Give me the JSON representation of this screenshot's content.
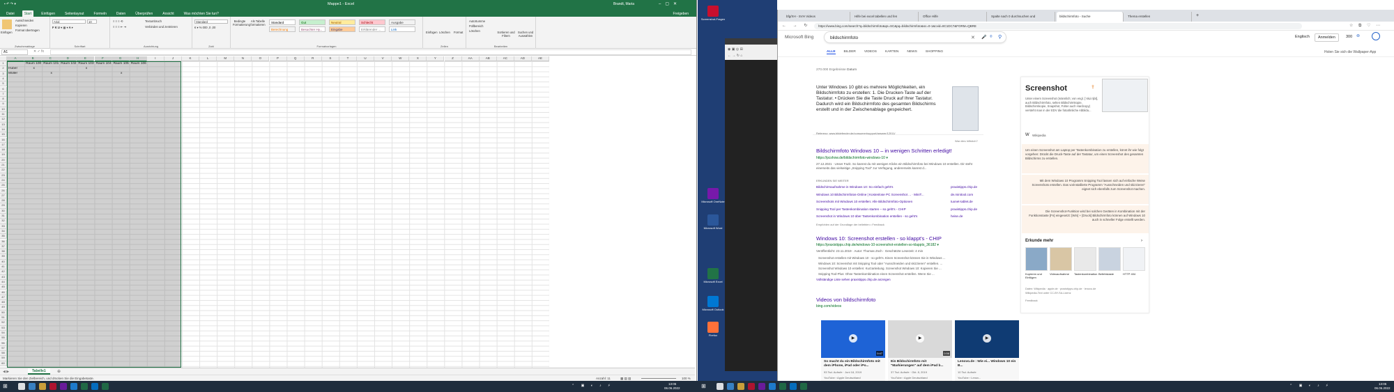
{
  "excel": {
    "window_title": "Mappe1 - Excel",
    "user": "Brandt, Maria",
    "share": "Freigeben",
    "tabs": [
      "Datei",
      "Start",
      "Einfügen",
      "Seitenlayout",
      "Formeln",
      "Daten",
      "Überprüfen",
      "Ansicht",
      "Was möchten Sie tun?"
    ],
    "active_tab": "Start",
    "ribbon": {
      "clipboard": {
        "paste": "Einfügen",
        "cut": "Ausschneiden",
        "copy": "Kopieren",
        "format_painter": "Format übertragen",
        "label": "Zwischenablage"
      },
      "font": {
        "name": "Arial",
        "size": "10",
        "label": "Schriftart"
      },
      "alignment": {
        "wrap": "Textumbruch",
        "merge": "Verbinden und zentrieren",
        "label": "Ausrichtung"
      },
      "number": {
        "format": "Standard",
        "label": "Zahl"
      },
      "conditional": "Bedingte Formatierung",
      "as_table": "Als Tabelle formatieren",
      "styles": [
        {
          "name": "Standard",
          "bg": "#ffffff",
          "fg": "#000000"
        },
        {
          "name": "Gut",
          "bg": "#c6efce",
          "fg": "#006100"
        },
        {
          "name": "Neutral",
          "bg": "#ffeb9c",
          "fg": "#9c5700"
        },
        {
          "name": "Schlecht",
          "bg": "#ffc7ce",
          "fg": "#9c0006"
        },
        {
          "name": "Ausgabe",
          "bg": "#f2f2f2",
          "fg": "#3f3f3f"
        },
        {
          "name": "Berechnung",
          "bg": "#f2f2f2",
          "fg": "#fa7d00"
        },
        {
          "name": "Besuchter Hy...",
          "bg": "#ffffff",
          "fg": "#954f72"
        },
        {
          "name": "Eingabe",
          "bg": "#ffcc99",
          "fg": "#3f3f76"
        },
        {
          "name": "Erklärender ...",
          "bg": "#ffffff",
          "fg": "#7f7f7f"
        },
        {
          "name": "Link",
          "bg": "#ffffff",
          "fg": "#0563c1"
        }
      ],
      "styles_label": "Formatvorlagen",
      "cells": {
        "insert": "Einfügen",
        "delete": "Löschen",
        "format": "Format",
        "label": "Zellen"
      },
      "editing": {
        "autosum": "AutoSumme",
        "fill": "Füllbereich",
        "clear": "Löschen",
        "sort": "Sortieren und Filtern",
        "find": "Suchen und Auswählen",
        "label": "Bearbeiten"
      }
    },
    "name_box": "A1",
    "columns": [
      "A",
      "B",
      "C",
      "D",
      "E",
      "F",
      "G",
      "H",
      "I",
      "J",
      "K",
      "L",
      "M",
      "N",
      "O",
      "P",
      "Q",
      "R",
      "S",
      "T",
      "U",
      "V",
      "W",
      "X",
      "Y",
      "Z",
      "AA",
      "AB",
      "AC",
      "AD",
      "AE"
    ],
    "cells": {
      "row1": [
        "",
        "Raum 100",
        "Raum 101",
        "Raum 102",
        "Raum 103",
        "Raum 104",
        "Raum 105",
        "Raum 106"
      ],
      "row2": [
        "Huber",
        "x",
        "",
        "",
        "x",
        "",
        "",
        ""
      ],
      "row3": [
        "Müller",
        "",
        "x",
        "",
        "",
        "",
        "x",
        ""
      ]
    },
    "sheet_tab": "Tabelle1",
    "status_text": "Markieren Sie den Zielbereich, und drücken Sie die Eingabetaste.",
    "count": "Anzahl: 11",
    "zoom": "100 %"
  },
  "desktop": {
    "icons": [
      {
        "label": "Screenshot-Fragen",
        "color": "#c8102e"
      },
      {
        "label": "Microsoft OneNote",
        "color": "#7719aa"
      },
      {
        "label": "Microsoft Word",
        "color": "#2b579a"
      },
      {
        "label": "Microsoft Excel",
        "color": "#217346"
      },
      {
        "label": "Microsoft Outlook",
        "color": "#0078d4"
      },
      {
        "label": "Firefox",
        "color": "#ff7139"
      }
    ]
  },
  "browser": {
    "tabs": [
      "bfg/XH - SVH Videos",
      "Hilfe bei excel tabellen und fen",
      "Office Hilfe",
      "Spalte nach 0 durchsuchen und",
      "bildschirmfoto - Suche",
      "Thema erstellen"
    ],
    "active_tab_index": 4,
    "url": "https://www.bing.com/search?q=bildschirmfoto&qs=SC&pq=bildschirmfoto&sc=0-1&cvid=8C1DC7&FORM=QBRE",
    "search_query": "bildschirmfoto",
    "brand": "Microsoft Bing",
    "lang": "Englisch",
    "signin": "Anmelden",
    "points": "300",
    "filters": [
      "ALLE",
      "BILDER",
      "VIDEOS",
      "KARTEN",
      "NEWS",
      "SHOPPING"
    ],
    "count": "270.000 Ergebnisse",
    "date_filter": "Datum",
    "wallpaper": "Holen Sie sich die Wallpaper-App",
    "answer": {
      "text": "Unter Windows 10 gibt es mehrere Möglichkeiten, ein Bildschirmfoto zu erstellen: 1. Die Drucken-Taste auf der Tastatur. • Drücken Sie die Taste Druck auf Ihrer Tastatur. Dadurch wird ein Bildschirmfoto des gesamten Bildschirms erstellt und in der Zwischenablage gespeichert.",
      "ref": "Referenz: www.bitdefender.de/consumer/support/answer/12011/",
      "helpful": "War dies hilfreich?"
    },
    "results": [
      {
        "title": "Bildschirmfoto Windows 10 – in wenigen Schritten erledigt!",
        "url": "https://pcshow.de/bildschirmfoto-windows-10 ▾",
        "snippet": "27.12.2021 · Unser Fazit. So kannst du mit wenigen Klicks ein Bildschirmfoto bei Windows 10 erstellen. Dir steht einerseits das vielseitige „Snipping Tool“ zur Verfügung, andererseits kannst d...",
        "related_label": "ERKUNDEN SIE WEITER",
        "related": [
          {
            "text": "Bildschirmaufnahme in Windows 10: So einfach geht's",
            "src": "praxistipps.chip.de"
          },
          {
            "text": "Windows 10 Bildschirmfotos-Online | Kostenlose PC Screenshot ... · MiniT...",
            "src": "de.minitool.com"
          },
          {
            "text": "Screenshots mit Windows 10 erstellen: Alle Bildschirmfoto-Optionen",
            "src": "tuxnet-tablet.de"
          },
          {
            "text": "Snipping Tool per Tastenkombination starten – so geht's - CHIP",
            "src": "praxistipps.chip.de"
          },
          {
            "text": "Screenshot in Windows 10 über Tastenkombination erstellen - so geht's",
            "src": "heise.de"
          }
        ],
        "footer": "Empfohlen auf der Grundlage der beliebten • Feedback"
      },
      {
        "title": "Windows 10: Screenshot erstellen - so klappt's - CHIP",
        "url": "https://praxistipps.chip.de/windows-10-screenshot-erstellen-so-klappts_36182 ▾",
        "meta": "Veröffentlicht: 23.11.2019 · Autor: Thomas Zsch · Geschätzte Lesezeit: 4 min",
        "bullets": [
          "Screenshot erstellen mit Windows 10 - so geht's. Einen Screenshot können Sie in Windows ...",
          "Windows 10: Screenshot mit Snipping Tool oder \"Ausschneiden und skizzieren\" erstellen. ...",
          "Screenshot Windows 10 erstellen: Kurzanleitung. Screenshot Windows 10: Kopieren Sie ...",
          "Snipping Tool-Plus: Ohne Tastenkombination einen Screenshot erstellen. Wenn Sie ..."
        ],
        "more": "Vollständige Liste sehen praxistipps.chip.de anzeigen"
      }
    ],
    "videos": {
      "title": "Videos von bildschirmfoto",
      "url": "bing.com/videos",
      "items": [
        {
          "title": "So macht du ein Bildschirmfoto mit dem iPhone, iPad oder iPo...",
          "meta": "93 Tsd. Aufrufe · Juni 18, 2019",
          "src": "YouTube › Apple Deutschland",
          "dur": "0:47"
        },
        {
          "title": "Ein Bildschirmfoto mit \"Markierungen\" auf dem iPad b...",
          "meta": "37 Tsd. Aufrufe · Okt. 8, 2019",
          "src": "YouTube › Apple Deutschland",
          "dur": "0:56"
        },
        {
          "title": "Lenovo.de : Wie ei... Windows 10 ein B...",
          "meta": "10 Tsd. Aufrufe",
          "src": "YouTube › Lenov...",
          "dur": ""
        }
      ]
    },
    "knowledge": {
      "title": "Screenshot",
      "desc": "Unter einem Screenshot (männlich; von engl. [ˈskɹiːnʃɒt], auch Bildschirmfoto, selten Bildschirmkopie, Bildschirmkopie, Snapshot, Folter auch Hardcopy) versteht man in der EDV die fotoähnliche Abbildu...",
      "wiki": "Wikipedia",
      "box1": "Um einen Screenshot am Laptop per Tastenkombination zu erstellen, könnt ihr wie folgt vorgehen: Drückt die Druck-Taste auf der Tastatur, um einen Screenshot des gesamten Bildschirms zu erstellen.",
      "box2": "Mit dem Windows 10 Programm Snipping Tool lassen sich auf einfache Weise Screenshots erstellen. Das vorinstallierte Programm \"Ausschneiden und skizzieren\" eignet sich ebenfalls zum Screenshot machen.",
      "box3": "Die Screenshot-Funktion wird bei solchen Geräten in Kombination mit der Funktionstaste [Fn] eingesetzt: [Win] + [Druck] Bildschirmfoto können auf Windows 10 auch in schneller Folge erstellt werden.",
      "explore": "Erkunde mehr",
      "explore_items": [
        "Kopieren und Einfügen",
        "Videoaufnahme",
        "Tastenkombination",
        "Befehlstaste",
        "HTTP 404"
      ],
      "sources": "Daten: Wikipedia · apple.de · praxistipps.chip.de · lenovo.de",
      "license": "Wikipedia-Text unter CC-BY-SA-Lizenz",
      "feedback": "Feedback"
    }
  },
  "clock": {
    "time": "13:05",
    "date": "06.06.2022"
  }
}
